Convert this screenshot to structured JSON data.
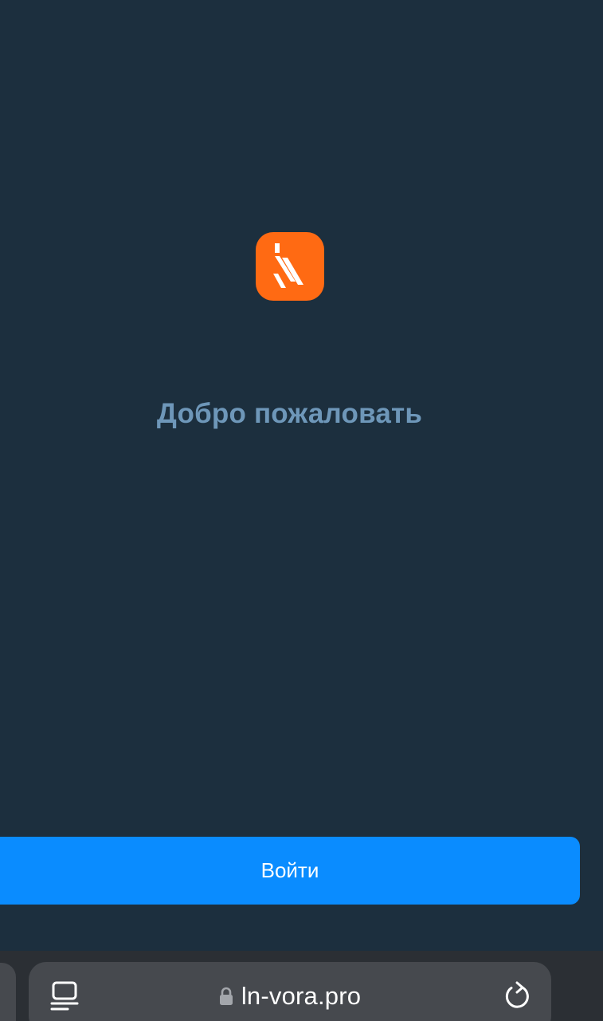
{
  "colors": {
    "background": "#1c2f3e",
    "logo_bg": "#ff6a13",
    "title_text": "#6e97b9",
    "primary_button": "#0a8cff",
    "browser_bar": "#2b2f34",
    "address_pill": "#46494e"
  },
  "welcome": {
    "logo_icon": "brand-logo-icon",
    "title": "Добро пожаловать"
  },
  "actions": {
    "login_label": "Войти"
  },
  "browser": {
    "url": "ln-vora.pro",
    "icons": [
      "tab-overview-icon",
      "lock-icon",
      "reload-icon"
    ]
  }
}
